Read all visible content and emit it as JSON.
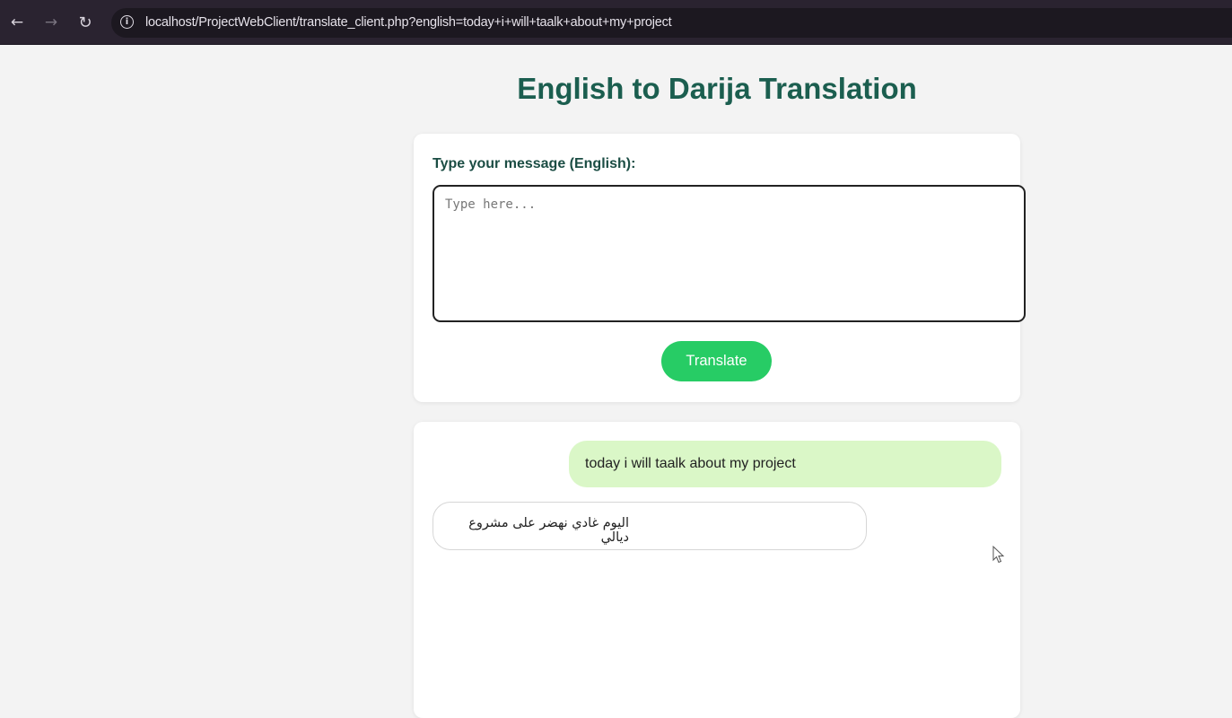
{
  "browser": {
    "back_icon": "arrow-left-icon",
    "forward_icon": "arrow-right-icon",
    "reload_icon": "reload-icon",
    "info_icon": "info-icon",
    "url": "localhost/ProjectWebClient/translate_client.php?english=today+i+will+taalk+about+my+project"
  },
  "page": {
    "title": "English to Darija Translation"
  },
  "form": {
    "label": "Type your message (English):",
    "input_value": "",
    "input_placeholder": "Type here...",
    "button_label": "Translate"
  },
  "chat": {
    "messages": [
      {
        "role": "user",
        "text": "today i will taalk about my project"
      },
      {
        "role": "bot",
        "text": "اليوم غادي نهضر على مشروع ديالي"
      }
    ]
  },
  "colors": {
    "title": "#1b5e4f",
    "button": "#27cc65",
    "user_bubble": "#daf7c7",
    "browser_bar": "#2a2330"
  }
}
